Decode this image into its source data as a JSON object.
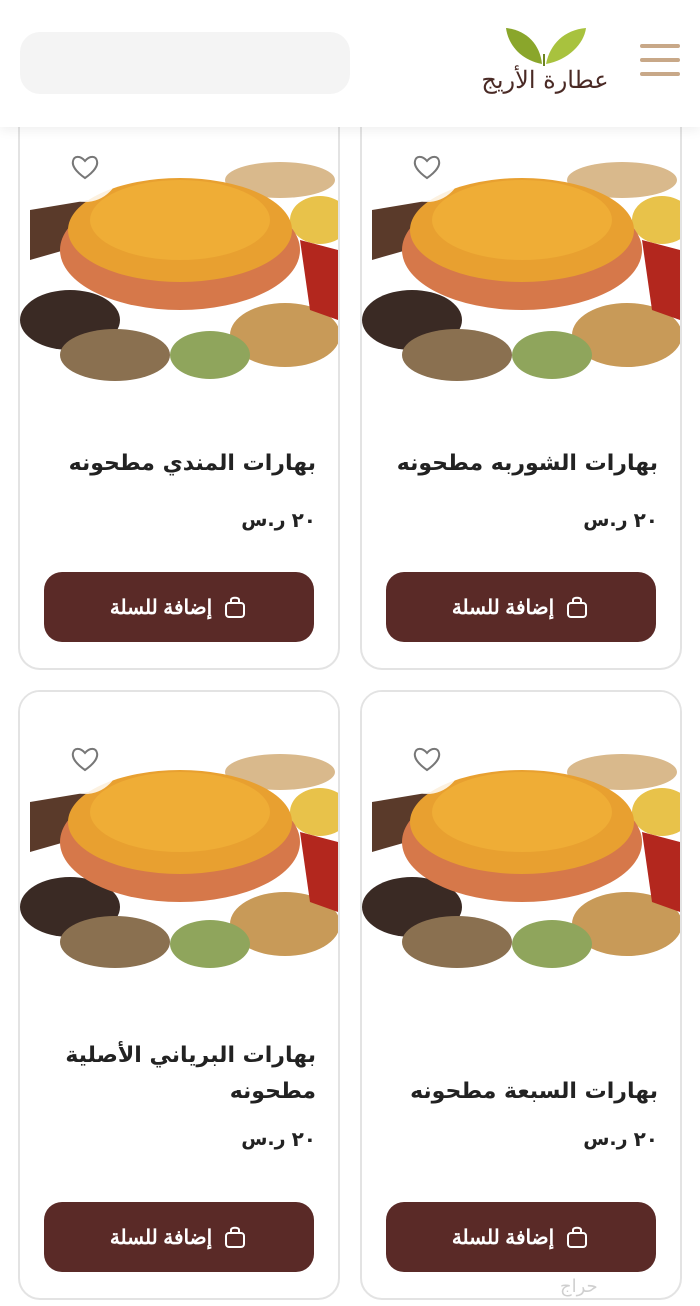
{
  "header": {
    "logo_text": "عطارة الأريج",
    "menu_icon": "hamburger-menu-icon"
  },
  "products": [
    {
      "title": "بهارات الشوربه مطحونه",
      "price": "٢٠",
      "currency": "ر.س",
      "button_label": "إضافة للسلة"
    },
    {
      "title": "بهارات المندي مطحونه",
      "price": "٢٠",
      "currency": "ر.س",
      "button_label": "إضافة للسلة"
    },
    {
      "title": "بهارات السبعة مطحونه",
      "price": "٢٠",
      "currency": "ر.س",
      "button_label": "إضافة للسلة"
    },
    {
      "title": "بهارات البرياني الأصلية مطحونه",
      "price": "٢٠",
      "currency": "ر.س",
      "button_label": "إضافة للسلة"
    }
  ],
  "watermark": "حراج",
  "colors": {
    "brand": "#5a2a27",
    "accent": "#c8a888",
    "leaf": "#9bb43a"
  }
}
